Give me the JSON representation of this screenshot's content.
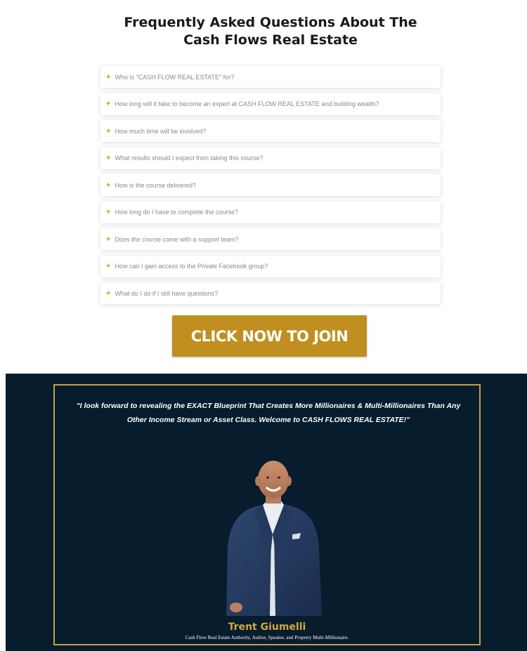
{
  "faq": {
    "title": "Frequently Asked Questions About The Cash Flows Real Estate",
    "items": [
      {
        "question": "Who is \"CASH FLOW REAL ESTATE\" for?"
      },
      {
        "question": "How long will it take to become an expert at CASH FLOW REAL ESTATE and building wealth?"
      },
      {
        "question": "How much time will be involved?"
      },
      {
        "question": "What results should I expect from taking this course?"
      },
      {
        "question": "How is the course delivered?"
      },
      {
        "question": "How long do I have to complete the course?"
      },
      {
        "question": "Does the course come with a support team?"
      },
      {
        "question": "How can I gain access to the Private Facebook group?"
      },
      {
        "question": "What do I do if I still have questions?"
      }
    ],
    "icon": "plus-icon",
    "accent_color": "#c79a2a"
  },
  "cta": {
    "label": "CLICK NOW TO JOIN",
    "color": "#c08f1f"
  },
  "testimonial": {
    "quote": "\"I look forward to revealing the EXACT Blueprint That Creates More Millionaires & Multi-Millionaires Than Any Other Income Stream or Asset Class. Welcome to CASH FLOWS REAL ESTATE!\"",
    "name": "Trent Giumelli",
    "subtitle": "Cash Flow Real Estate Authority, Author, Speaker,  and Property Multi-Millionaire.",
    "background_color": "#071c2c",
    "border_color": "#c2a14e",
    "name_color": "#d4a83a"
  }
}
